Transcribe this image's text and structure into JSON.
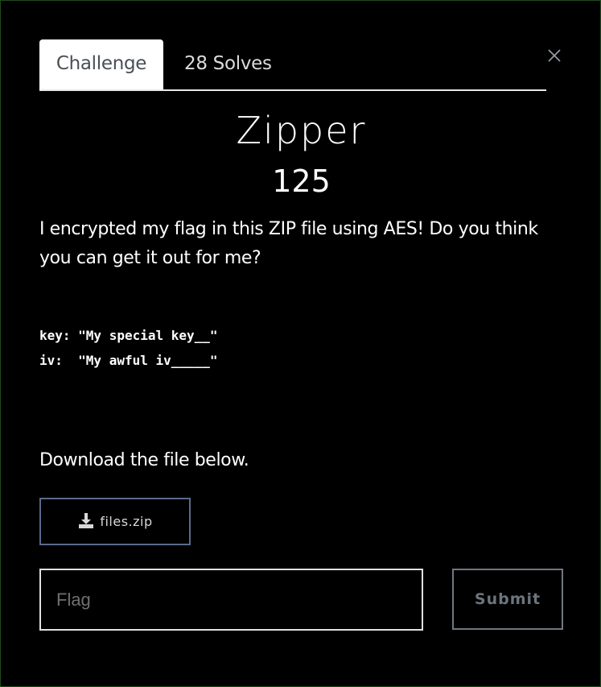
{
  "tabs": {
    "challenge": "Challenge",
    "solves": "28 Solves"
  },
  "challenge": {
    "name": "Zipper",
    "points": "125",
    "description": "I encrypted my flag in this ZIP file using AES! Do you think you can get it out for me?",
    "code_lines": [
      "key: \"My special key__\"",
      "iv:  \"My awful iv_____\""
    ],
    "download_text": "Download the file below.",
    "file_label": "files.zip"
  },
  "form": {
    "flag_placeholder": "Flag",
    "submit_label": "Submit"
  },
  "icons": {
    "close": "close-icon",
    "download": "download-icon"
  },
  "colors": {
    "background": "#000000",
    "tab_active_bg": "#ffffff",
    "file_border": "#5a6a8a",
    "submit_text": "#6c757d"
  }
}
